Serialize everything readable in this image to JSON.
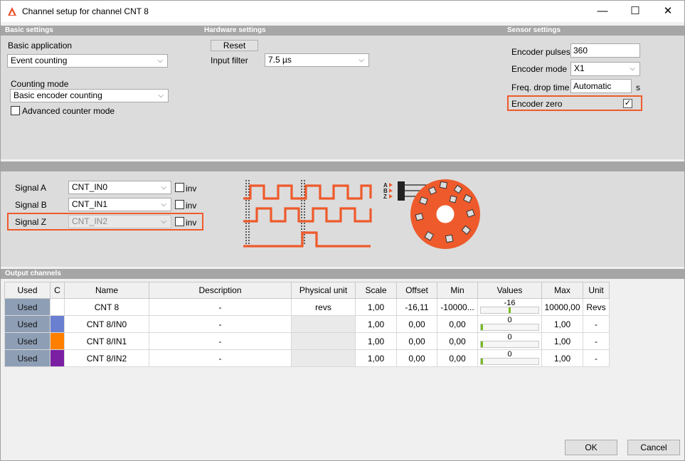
{
  "window": {
    "title": "Channel setup for channel CNT 8",
    "controls": {
      "minimize": "—",
      "maximize": "☐",
      "close": "✕"
    }
  },
  "basic_settings": {
    "header": "Basic settings",
    "application_label": "Basic application",
    "application_value": "Event counting",
    "counting_mode_label": "Counting mode",
    "counting_mode_value": "Basic encoder counting",
    "advanced_label": "Advanced counter mode",
    "advanced_checked": false
  },
  "hardware_settings": {
    "header": "Hardware settings",
    "reset_label": "Reset",
    "input_filter_label": "Input filter",
    "input_filter_value": "7.5 µs"
  },
  "sensor_settings": {
    "header": "Sensor settings",
    "pulses_label": "Encoder pulses",
    "pulses_value": "360",
    "mode_label": "Encoder mode",
    "mode_value": "X1",
    "freq_label": "Freq. drop time",
    "freq_value": "Automatic",
    "freq_unit": "s",
    "zero_label": "Encoder zero",
    "zero_checked": true
  },
  "signals": [
    {
      "label": "Signal A",
      "value": "CNT_IN0",
      "inv_label": "inv",
      "enabled": true
    },
    {
      "label": "Signal B",
      "value": "CNT_IN1",
      "inv_label": "inv",
      "enabled": true
    },
    {
      "label": "Signal Z",
      "value": "CNT_IN2",
      "inv_label": "inv",
      "enabled": false
    }
  ],
  "diagram": {
    "encoder_labels": [
      "A",
      "B",
      "Z"
    ],
    "accent": "#ee5a2b"
  },
  "output_channels": {
    "header": "Output channels",
    "columns": [
      "Used",
      "C",
      "Name",
      "Description",
      "Physical unit",
      "Scale",
      "Offset",
      "Min",
      "Values",
      "Max",
      "Unit"
    ],
    "rows": [
      {
        "used": "Used",
        "color": "#ffffff",
        "name": "CNT 8",
        "description": "-",
        "unit_phys": "revs",
        "scale": "1,00",
        "offset": "-16,11",
        "min": "-10000...",
        "value": "-16",
        "value_fraction": 0.5,
        "max": "10000,00",
        "unit": "Revs"
      },
      {
        "used": "Used",
        "color": "#6a7fd0",
        "name": "CNT 8/IN0",
        "description": "-",
        "unit_phys": "",
        "scale": "1,00",
        "offset": "0,00",
        "min": "0,00",
        "value": "0",
        "value_fraction": 0.0,
        "max": "1,00",
        "unit": "-"
      },
      {
        "used": "Used",
        "color": "#ff8000",
        "name": "CNT 8/IN1",
        "description": "-",
        "unit_phys": "",
        "scale": "1,00",
        "offset": "0,00",
        "min": "0,00",
        "value": "0",
        "value_fraction": 0.0,
        "max": "1,00",
        "unit": "-"
      },
      {
        "used": "Used",
        "color": "#7a1fa2",
        "name": "CNT 8/IN2",
        "description": "-",
        "unit_phys": "",
        "scale": "1,00",
        "offset": "0,00",
        "min": "0,00",
        "value": "0",
        "value_fraction": 0.0,
        "max": "1,00",
        "unit": "-"
      }
    ]
  },
  "footer": {
    "ok_label": "OK",
    "cancel_label": "Cancel"
  }
}
